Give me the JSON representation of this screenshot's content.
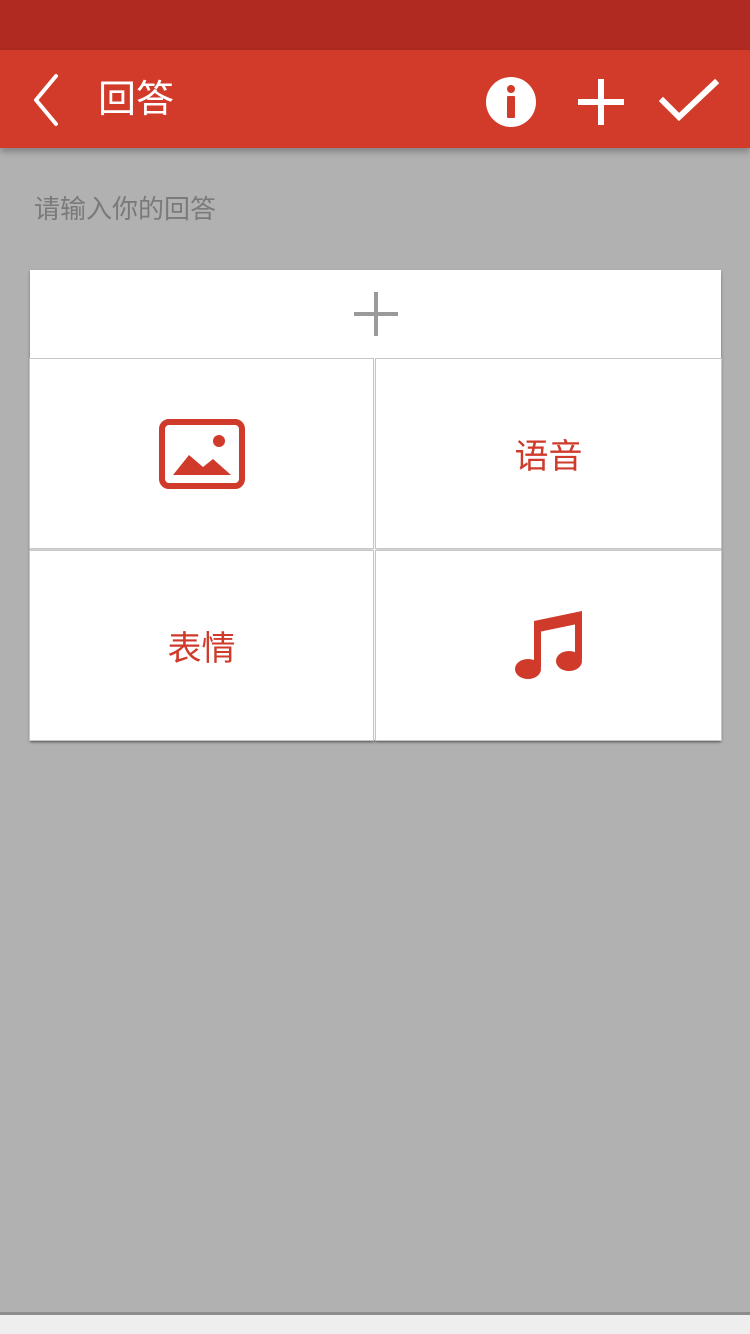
{
  "toolbar": {
    "title": "回答",
    "back_icon": "chevron-left-icon",
    "actions": [
      {
        "name": "info",
        "icon": "info-icon"
      },
      {
        "name": "add",
        "icon": "plus-icon"
      },
      {
        "name": "done",
        "icon": "check-icon"
      }
    ]
  },
  "content": {
    "hint": "请输入你的回答"
  },
  "attach_panel": {
    "add_icon": "plus-icon",
    "options": [
      {
        "type": "image",
        "icon": "image-icon"
      },
      {
        "type": "text",
        "label": "语音"
      },
      {
        "type": "text",
        "label": "表情"
      },
      {
        "type": "icon",
        "icon": "music-note-icon"
      }
    ]
  },
  "colors": {
    "status_bar": "#b02a21",
    "toolbar": "#d23a2a",
    "accent": "#cf3a2b",
    "background": "#b1b1b1"
  }
}
